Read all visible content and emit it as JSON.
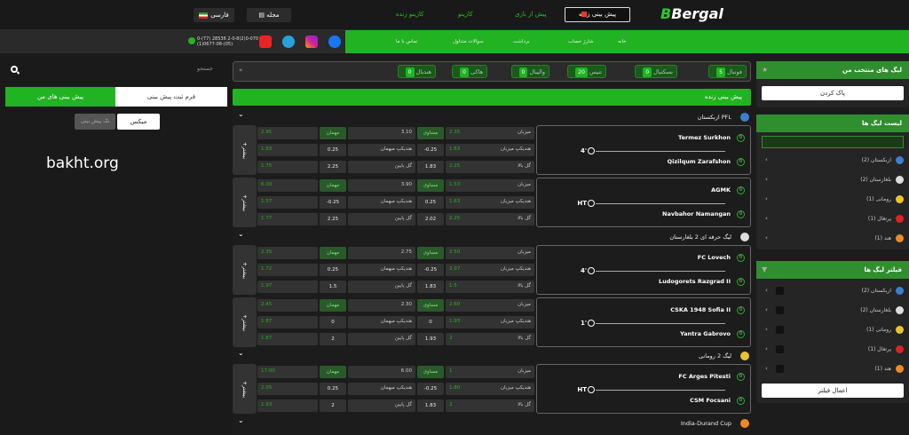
{
  "header": {
    "logo": "Bergal",
    "nav": [
      "پیش بینی زنده",
      "پیش از بازی",
      "کازینو",
      "کازینو زنده"
    ],
    "magazine": "مجله",
    "language": "فارسی"
  },
  "subheader": {
    "phones": [
      "0-(77) 28536 2-0-8(2)0-070",
      "(1)0677-08-(05)"
    ],
    "items": [
      "خانه",
      "شارژ حساب",
      "برداشت",
      "سوالات متداول",
      "تماس با ما"
    ]
  },
  "left_panel": {
    "search_label": "جستجو",
    "tab_form": "فرم ثبت پیش بینی",
    "tab_mine": "پیش بینی های من",
    "mix": "میکس",
    "single": "تک پیش بینی",
    "watermark": "bakht.org"
  },
  "sports_tabs": [
    {
      "label": "فوتبال",
      "count": "5"
    },
    {
      "label": "بسکتبال",
      "count": "0"
    },
    {
      "label": "تنیس",
      "count": "20"
    },
    {
      "label": "والیبال",
      "count": "0"
    },
    {
      "label": "هاکی",
      "count": "0"
    },
    {
      "label": "هندبال",
      "count": "0"
    }
  ],
  "live_title": "پیش بینی زنده",
  "leagues": [
    {
      "name": "ازبکستان PFL",
      "flag": "#3a7fd0"
    },
    {
      "name": "لیگ حرفه ای 2 بلغارستان",
      "flag": "#ddd"
    },
    {
      "name": "لیگ 2 رومانی",
      "flag": "#e7c42c"
    },
    {
      "name": "India-Durand Cup",
      "flag": "#f08a1e"
    }
  ],
  "matches": [
    {
      "home": "Termez Surkhon",
      "away": "Qizilqum Zarafshon",
      "time": "4'",
      "home_score": "0",
      "away_score": "0",
      "odds": [
        [
          "میزبان",
          "2.35",
          "مساوی",
          "3.10",
          "مهمان",
          "2.95"
        ],
        [
          "هندیکپ میزبان",
          "1.63",
          "-0.25",
          "هندیکپ میهمان",
          "0.25",
          "1.83"
        ],
        [
          "گل بالا",
          "2.25",
          "1.83",
          "گل پایین",
          "2.25",
          "1.75"
        ]
      ]
    },
    {
      "home": "AGMK",
      "away": "Navbahor Namangan",
      "time": "HT",
      "home_score": "0",
      "away_score": "0",
      "odds": [
        [
          "میزبان",
          "1.53",
          "مساوی",
          "3.90",
          "مهمان",
          "6.00"
        ],
        [
          "هندیکپ میزبان",
          "1.63",
          "0.25",
          "هندیکپ میهمان",
          "-0.25",
          "1.57"
        ],
        [
          "گل بالا",
          "2.25",
          "2.02",
          "گل پایین",
          "2.25",
          "1.77"
        ]
      ]
    },
    {
      "home": "FC Lovech",
      "away": "Ludogorets Razgrad II",
      "time": "4'",
      "home_score": "0",
      "away_score": "0",
      "odds": [
        [
          "میزبان",
          "2.50",
          "مساوی",
          "2.75",
          "مهمان",
          "2.35"
        ],
        [
          "هندیکپ میزبان",
          "2.07",
          "-0.25",
          "هندیکپ میهمان",
          "0.25",
          "1.72"
        ],
        [
          "گل بالا",
          "1.5",
          "1.83",
          "گل پایین",
          "1.5",
          "1.97"
        ]
      ]
    },
    {
      "home": "CSKA 1948 Sofia II",
      "away": "Yantra Gabrovo",
      "time": "1'",
      "home_score": "0",
      "away_score": "0",
      "odds": [
        [
          "میزبان",
          "2.60",
          "مساوی",
          "2.30",
          "مهمان",
          "2.45"
        ],
        [
          "هندیکپ میزبان",
          "1.93",
          "0",
          "هندیکپ میهمان",
          "0",
          "1.87"
        ],
        [
          "گل بالا",
          "2",
          "1.93",
          "گل پایین",
          "2",
          "1.87"
        ]
      ]
    },
    {
      "home": "FC Arges Pitesti",
      "away": "CSM Focsani",
      "time": "HT",
      "home_score": "0",
      "away_score": "0",
      "odds": [
        [
          "میزبان",
          "1",
          "مساوی",
          "6.00",
          "مهمان",
          "17.00"
        ],
        [
          "هندیکپ میزبان",
          "1.80",
          "-0.25",
          "هندیکپ میهمان",
          "0.25",
          "2.05"
        ],
        [
          "گل بالا",
          "2",
          "1.83",
          "گل پایین",
          "2",
          "1.93"
        ]
      ]
    }
  ],
  "more_label": "+بیشتر",
  "right_panel": {
    "fav_title": "لیگ های منتخب من",
    "clear_btn": "پاک کردن",
    "list_title": "لیست لیگ ها",
    "list_items": [
      {
        "name": "ازبکستان (2)",
        "flag": "#3a7fd0"
      },
      {
        "name": "بلغارستان (2)",
        "flag": "#ddd"
      },
      {
        "name": "رومانی (1)",
        "flag": "#e7c42c"
      },
      {
        "name": "پرتغال (1)",
        "flag": "#d22"
      },
      {
        "name": "هند (1)",
        "flag": "#f08a1e"
      }
    ],
    "filter_title": "فیلتر لیگ ها",
    "filter_items": [
      {
        "name": "ازبکستان (2)",
        "flag": "#3a7fd0"
      },
      {
        "name": "بلغارستان (2)",
        "flag": "#ddd"
      },
      {
        "name": "رومانی (1)",
        "flag": "#e7c42c"
      },
      {
        "name": "پرتغال (1)",
        "flag": "#d22"
      },
      {
        "name": "هند (1)",
        "flag": "#f08a1e"
      }
    ],
    "apply_btn": "اعمال فیلتر"
  }
}
